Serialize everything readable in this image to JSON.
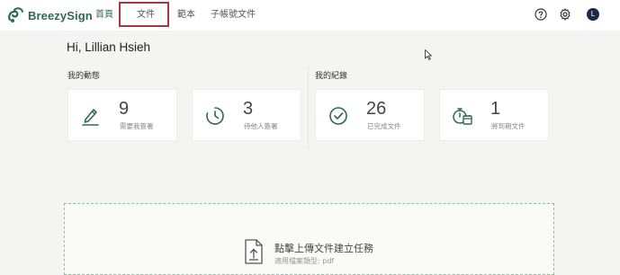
{
  "header": {
    "brand": "BreezySign",
    "nav": [
      {
        "label": "首頁",
        "active": true
      },
      {
        "label": "文件",
        "active": false,
        "highlighted": true
      },
      {
        "label": "範本",
        "active": false
      },
      {
        "label": "子帳號文件",
        "active": false
      }
    ],
    "icons": [
      "help-icon",
      "gear-icon"
    ],
    "avatar_letter": "L"
  },
  "greeting": "Hi, Lillian Hsieh",
  "sections": {
    "activity_label": "我的動態",
    "records_label": "我的紀錄"
  },
  "cards": [
    {
      "value": "9",
      "label": "需要我簽署",
      "icon": "pen-icon"
    },
    {
      "value": "3",
      "label": "待他人簽署",
      "icon": "clock-icon"
    },
    {
      "value": "26",
      "label": "已完成文件",
      "icon": "check-circle-icon"
    },
    {
      "value": "1",
      "label": "將到期文件",
      "icon": "expiring-timer-icon"
    }
  ],
  "upload": {
    "title": "點擊上傳文件建立任務",
    "subtitle": "適用檔案類型: pdf"
  },
  "colors": {
    "brand_green": "#2d6b4e",
    "highlight_red": "#b2343b",
    "background": "#f4f4f2"
  }
}
